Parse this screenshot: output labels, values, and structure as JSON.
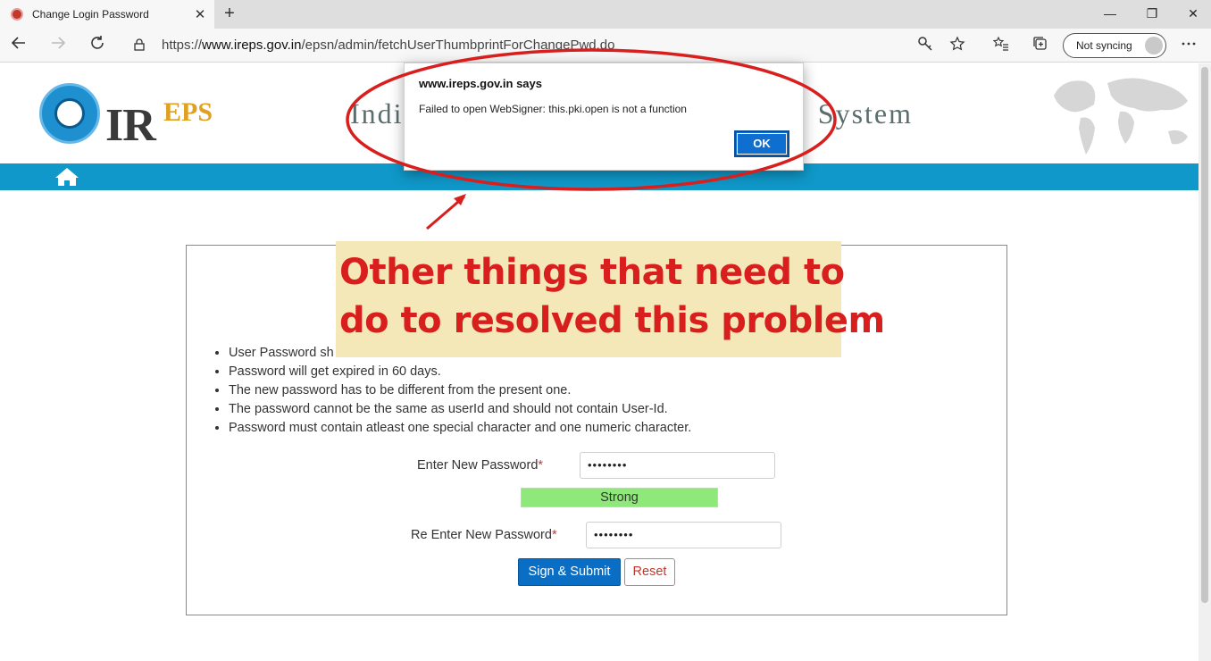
{
  "browser": {
    "tab_title": "Change Login Password",
    "tab_close": "✕",
    "new_tab": "+",
    "url_prefix": "https://",
    "url_domain": "www.ireps.gov.in",
    "url_path": "/epsn/admin/fetchUserThumbprintForChangePwd.do",
    "sync_label": "Not syncing",
    "window_controls": [
      "—",
      "❐",
      "✕"
    ]
  },
  "site": {
    "logo_ir": "IR",
    "logo_eps": "EPS",
    "title_left": "Indi",
    "title_right": "System"
  },
  "form": {
    "rules": [
      "User Password sh",
      "Password will get expired in 60 days.",
      "The new password has to be different from the present one.",
      "The password cannot be the same as userId and should not contain User-Id.",
      "Password must contain atleast one special character and one numeric character."
    ],
    "new_password_label": "Enter New Password",
    "new_password_value": "••••••••",
    "strength_label": "Strong",
    "reenter_password_label": "Re Enter New Password",
    "reenter_password_value": "••••••••",
    "required_mark": "*",
    "sign_submit_label": "Sign & Submit",
    "reset_label": "Reset"
  },
  "dialog": {
    "title": "www.ireps.gov.in says",
    "message": "Failed to open WebSigner: this.pki.open is not a function",
    "ok_label": "OK"
  },
  "annotation": {
    "line1": "Other things that need to",
    "line2": "do to resolved this problem",
    "color": "#d91e1e"
  },
  "colors": {
    "brand_blue": "#0f98c9",
    "button_blue": "#0a6fc4",
    "strength_green": "#8ee87a"
  }
}
